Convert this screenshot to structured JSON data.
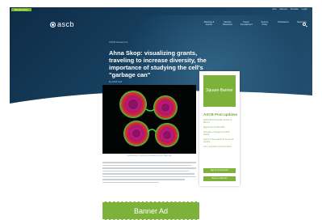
{
  "header": {
    "membership_tab": "Membership",
    "utility_links": [
      "Join",
      "Renew",
      "Donate",
      "Login"
    ],
    "logo_text": "ascb",
    "nav_items": [
      "Meetings & Events",
      "Member Resources",
      "Career Development",
      "Science Policy",
      "Publications",
      "Newsroom"
    ]
  },
  "article": {
    "category": "ASCB Newsroom",
    "title": "Ahna Skop: visualizing grants, traveling to increase diversity, the importance of studying the cell's \"garbage can\"",
    "byline": "By ASCB Staff",
    "image_caption": "Cell division in embryos visualized in the Skop lab"
  },
  "sidebar": {
    "square_banner": "Square Banner",
    "updates_title": "ASCB Post updates",
    "updates": [
      "2025 Call for Proposals: Submit by March 1",
      "Register for Cell Bio 2025",
      "Nominate a colleague for ASCB awards",
      "Apply for travel awards to the annual meeting",
      "Join a committee and get involved"
    ],
    "button_newsletter": "Sign up for Newsletter",
    "button_member": "Become a Member"
  },
  "banner_ad": "Banner Ad",
  "colors": {
    "navy": "#16405f",
    "green": "#7db23a"
  }
}
